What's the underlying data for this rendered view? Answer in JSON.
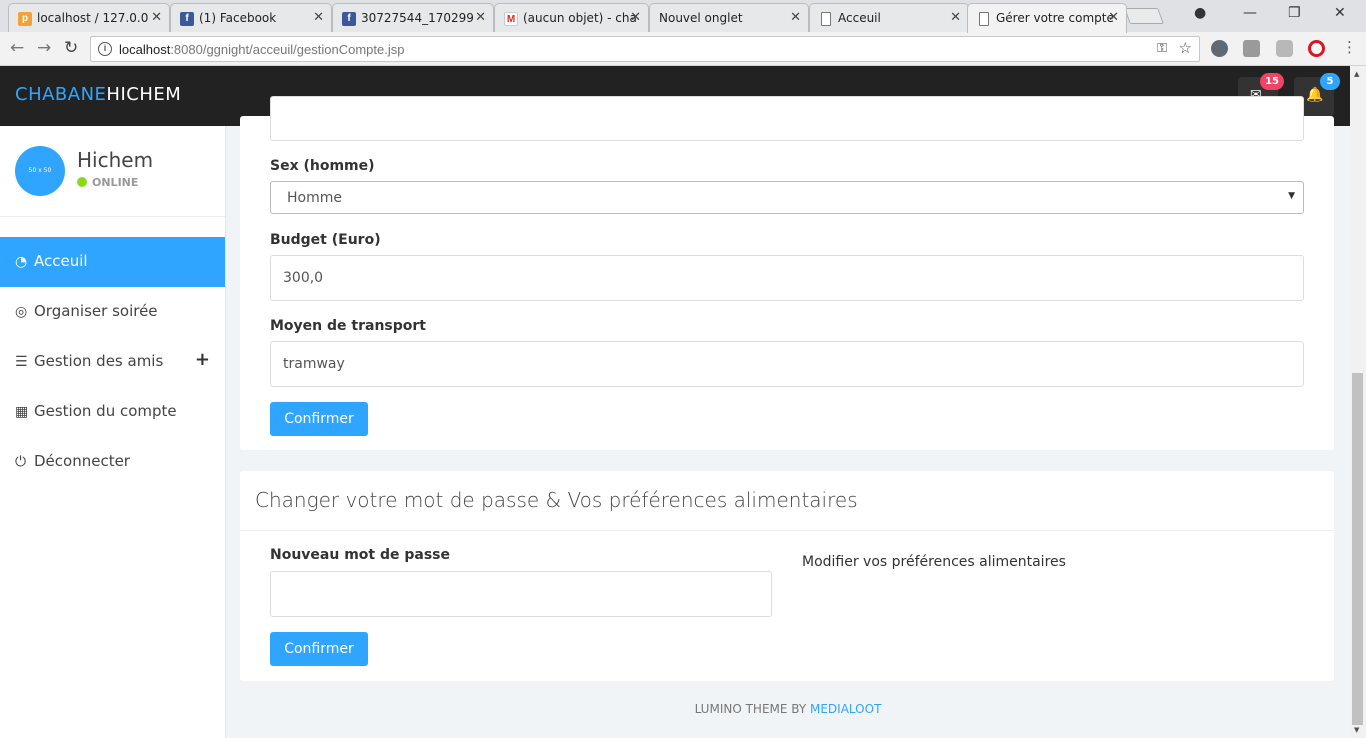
{
  "browser": {
    "tabs": [
      {
        "title": "localhost / 127.0.0",
        "favicon": "phpmyadmin-icon"
      },
      {
        "title": "(1) Facebook",
        "favicon": "facebook-icon"
      },
      {
        "title": "30727544_170299",
        "favicon": "facebook-icon"
      },
      {
        "title": "(aucun objet) - cha",
        "favicon": "gmail-icon"
      },
      {
        "title": "Nouvel onglet",
        "favicon": ""
      },
      {
        "title": "Acceuil",
        "favicon": "page-icon"
      },
      {
        "title": "Gérer votre compte",
        "favicon": "page-icon",
        "active": true
      }
    ],
    "url_host": "localhost",
    "url_path": ":8080/ggnight/acceuil/gestionCompte.jsp"
  },
  "header": {
    "brand_first": "CHABANE",
    "brand_second": "HICHEM",
    "messages_count": "15",
    "notifications_count": "5"
  },
  "sidebar": {
    "avatar_text": "50 x 50",
    "user_name": "Hichem",
    "status": "ONLINE",
    "items": [
      {
        "label": "Acceuil",
        "icon": "dashboard-icon",
        "active": true
      },
      {
        "label": "Organiser soirée",
        "icon": "toggle-icon"
      },
      {
        "label": "Gestion des amis",
        "icon": "list-icon"
      },
      {
        "label": "Gestion du compte",
        "icon": "calendar-icon"
      },
      {
        "label": "Déconnecter",
        "icon": "power-icon"
      }
    ]
  },
  "account_form": {
    "sex_label": "Sex (homme)",
    "sex_value": "Homme",
    "budget_label": "Budget (Euro)",
    "budget_value": "300,0",
    "transport_label": "Moyen de transport",
    "transport_value": "tramway",
    "confirm_label": "Confirmer"
  },
  "password_panel": {
    "title": "Changer votre mot de passe & Vos préférences alimentaires",
    "password_label": "Nouveau mot de passe",
    "password_value": "",
    "preferences_link": "Modifier vos préférences alimentaires",
    "confirm_label": "Confirmer"
  },
  "footer": {
    "text": "LUMINO THEME BY ",
    "link": "MEDIALOOT"
  },
  "colors": {
    "accent": "#30a5ff",
    "header_bg": "#222222",
    "messages_badge": "#ef4565",
    "notifications_badge": "#30a5ff",
    "online": "#8ad919"
  }
}
